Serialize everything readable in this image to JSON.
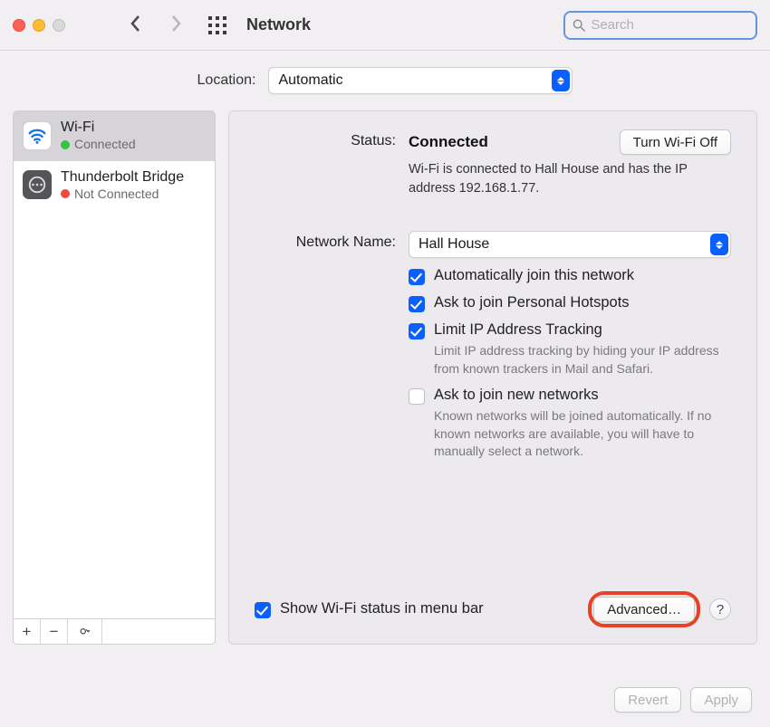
{
  "window": {
    "title": "Network"
  },
  "search": {
    "placeholder": "Search"
  },
  "location": {
    "label": "Location:",
    "value": "Automatic"
  },
  "services": [
    {
      "name": "Wi-Fi",
      "status": "Connected",
      "status_color": "green",
      "selected": true
    },
    {
      "name": "Thunderbolt Bridge",
      "status": "Not Connected",
      "status_color": "red",
      "selected": false
    }
  ],
  "detail": {
    "status_label": "Status:",
    "status_value": "Connected",
    "wifi_toggle": "Turn Wi-Fi Off",
    "status_sub": "Wi-Fi is connected to Hall House and has the IP address 192.168.1.77.",
    "netname_label": "Network Name:",
    "netname_value": "Hall House",
    "checks": {
      "auto_join": "Automatically join this network",
      "ask_hotspot": "Ask to join Personal Hotspots",
      "limit_ip": "Limit IP Address Tracking",
      "limit_ip_help": "Limit IP address tracking by hiding your IP address from known trackers in Mail and Safari.",
      "ask_new": "Ask to join new networks",
      "ask_new_help": "Known networks will be joined automatically. If no known networks are available, you will have to manually select a network."
    },
    "show_status": "Show Wi-Fi status in menu bar",
    "advanced": "Advanced…",
    "help": "?"
  },
  "footer": {
    "revert": "Revert",
    "apply": "Apply"
  }
}
